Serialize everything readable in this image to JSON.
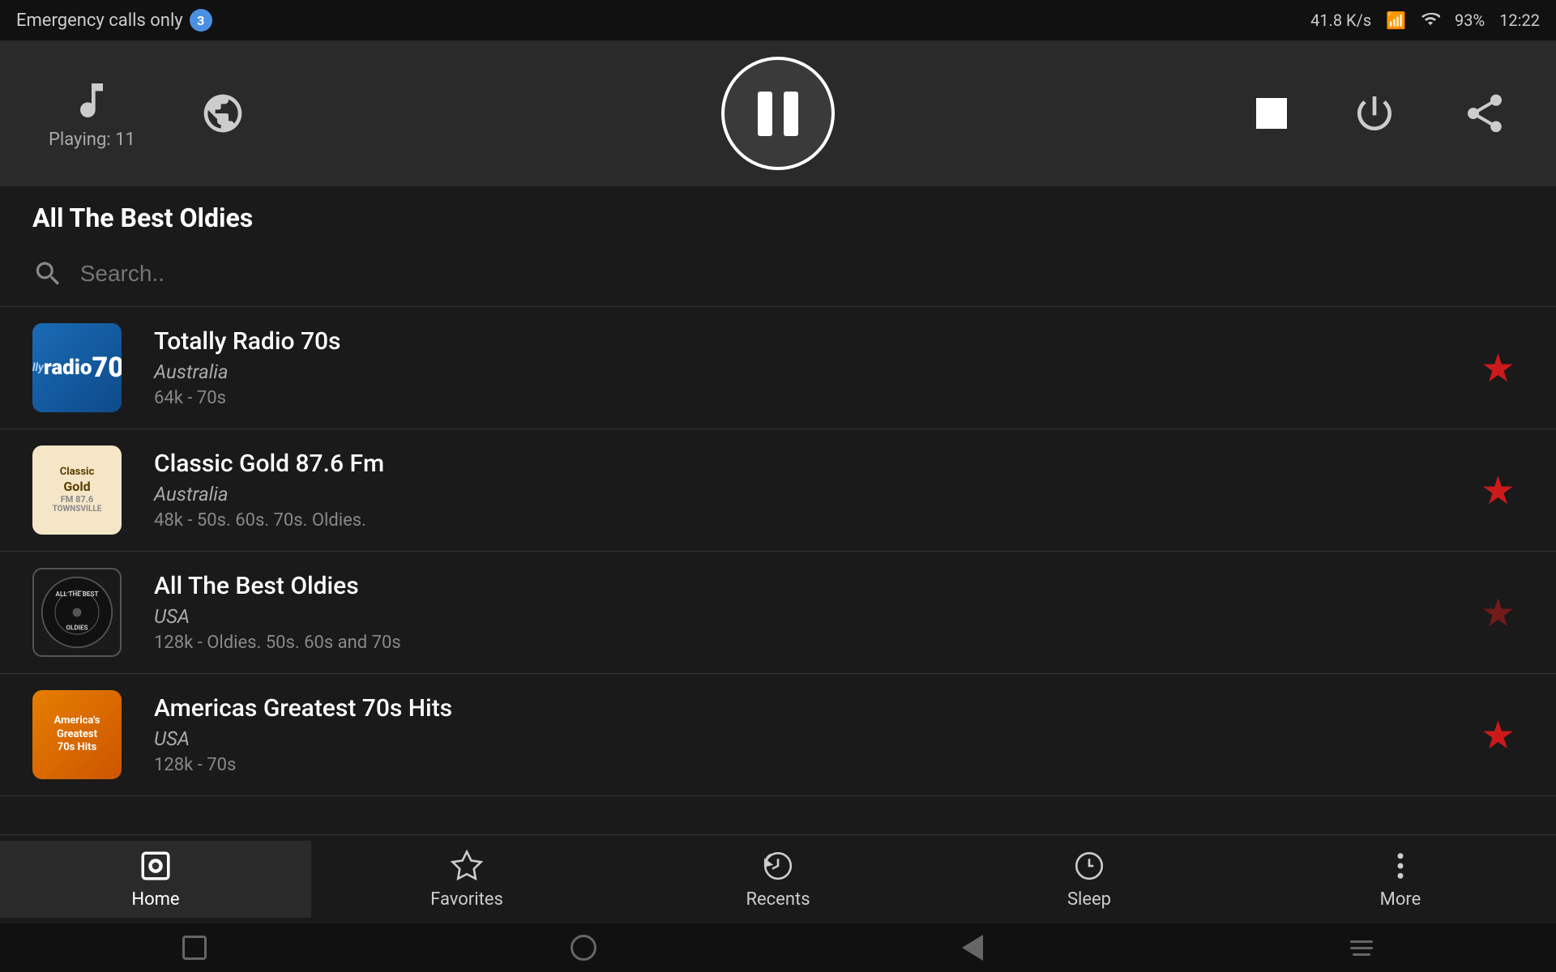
{
  "statusBar": {
    "emergencyText": "Emergency calls only",
    "badge": "3",
    "rightInfo": "41.8 K/s",
    "battery": "93%",
    "time": "12:22"
  },
  "player": {
    "playingLabel": "Playing: 11",
    "currentStation": "All The Best Oldies"
  },
  "search": {
    "placeholder": "Search.."
  },
  "stations": [
    {
      "id": 1,
      "name": "Totally Radio 70s",
      "country": "Australia",
      "meta": "64k - 70s",
      "favorited": true
    },
    {
      "id": 2,
      "name": "Classic Gold 87.6 Fm",
      "country": "Australia",
      "meta": "48k - 50s. 60s. 70s. Oldies.",
      "favorited": true
    },
    {
      "id": 3,
      "name": "All The Best Oldies",
      "country": "USA",
      "meta": "128k - Oldies. 50s. 60s and 70s",
      "favorited": false
    },
    {
      "id": 4,
      "name": "Americas Greatest 70s Hits",
      "country": "USA",
      "meta": "128k - 70s",
      "favorited": true
    }
  ],
  "nav": {
    "items": [
      {
        "id": "home",
        "label": "Home",
        "active": true
      },
      {
        "id": "favorites",
        "label": "Favorites",
        "active": false
      },
      {
        "id": "recents",
        "label": "Recents",
        "active": false
      },
      {
        "id": "sleep",
        "label": "Sleep",
        "active": false
      },
      {
        "id": "more",
        "label": "More",
        "active": false
      }
    ]
  }
}
